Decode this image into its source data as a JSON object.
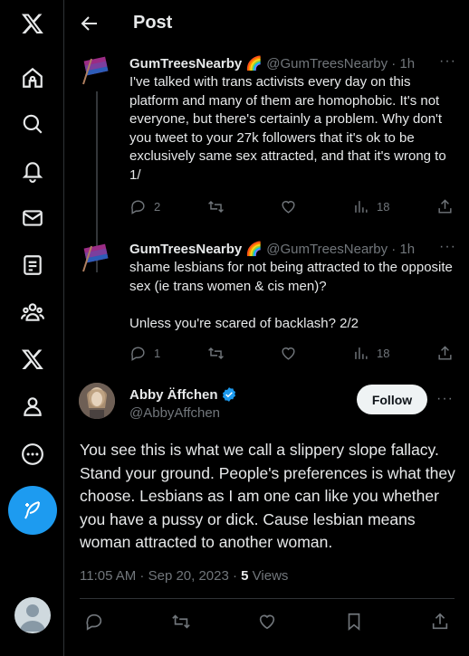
{
  "header": {
    "title": "Post"
  },
  "nav": {
    "items": [
      {
        "icon": "x-logo-icon"
      },
      {
        "icon": "home-icon"
      },
      {
        "icon": "search-icon"
      },
      {
        "icon": "notifications-icon"
      },
      {
        "icon": "messages-icon"
      },
      {
        "icon": "lists-icon"
      },
      {
        "icon": "communities-icon"
      },
      {
        "icon": "premium-x-icon"
      },
      {
        "icon": "profile-icon"
      },
      {
        "icon": "more-icon"
      }
    ],
    "compose_icon": "compose-icon"
  },
  "thread": [
    {
      "name": "GumTreesNearby 🌈",
      "handle": "@GumTreesNearby",
      "time": "· 1h",
      "text": "I've talked with trans activists every day on this platform and many of them are homophobic. It's not everyone, but there's certainly a problem. Why don't you tweet to your 27k followers that it's ok to be exclusively same sex attracted, and that it's wrong to 1/",
      "replies": "2",
      "reposts": "",
      "likes": "",
      "views": "18"
    },
    {
      "name": "GumTreesNearby 🌈",
      "handle": "@GumTreesNearby",
      "time": "· 1h",
      "text": "shame lesbians for not being attracted to the opposite sex (ie trans women & cis men)?\n\nUnless you're scared of backlash? 2/2",
      "replies": "1",
      "reposts": "",
      "likes": "",
      "views": "18"
    }
  ],
  "focus": {
    "name": "Abby Äffchen",
    "handle": "@AbbyAffchen",
    "follow_label": "Follow",
    "text": "You see this is what we call a slippery slope fallacy. Stand your ground. People's preferences is what they choose. Lesbians as I am one can like you whether you have a pussy or dick. Cause lesbian means woman attracted to another woman.",
    "time": "11:05 AM · Sep 20, 2023 · ",
    "views_count": "5",
    "views_label": " Views"
  },
  "colors": {
    "accent": "#1d9bf0",
    "background": "#000000",
    "muted": "#71767b",
    "text": "#e7e9ea"
  }
}
